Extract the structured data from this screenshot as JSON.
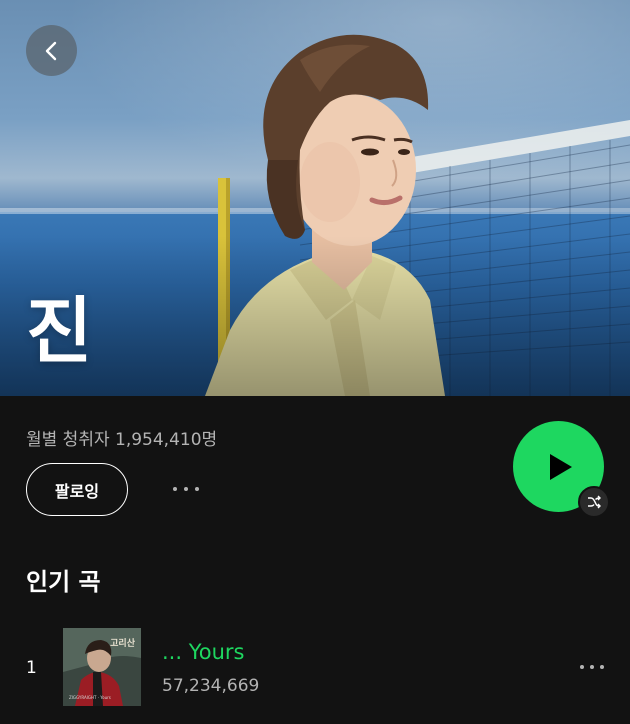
{
  "artist": {
    "name": "진",
    "monthly_listeners": "월별 청취자 1,954,410명"
  },
  "actions": {
    "follow_label": "팔로잉"
  },
  "popular": {
    "heading": "인기 곡",
    "tracks": [
      {
        "rank": "1",
        "title": "... Yours",
        "plays": "57,234,669",
        "art_title": "고리산",
        "art_caption": "ZIGGYRAIGHT · Yours"
      }
    ]
  },
  "icons": {
    "back": "chevron-left-icon",
    "play": "play-icon",
    "shuffle": "shuffle-icon",
    "more": "more-horizontal-icon"
  },
  "colors": {
    "background": "#121212",
    "accent": "#1ed760",
    "secondary_text": "#b3b3b3"
  }
}
